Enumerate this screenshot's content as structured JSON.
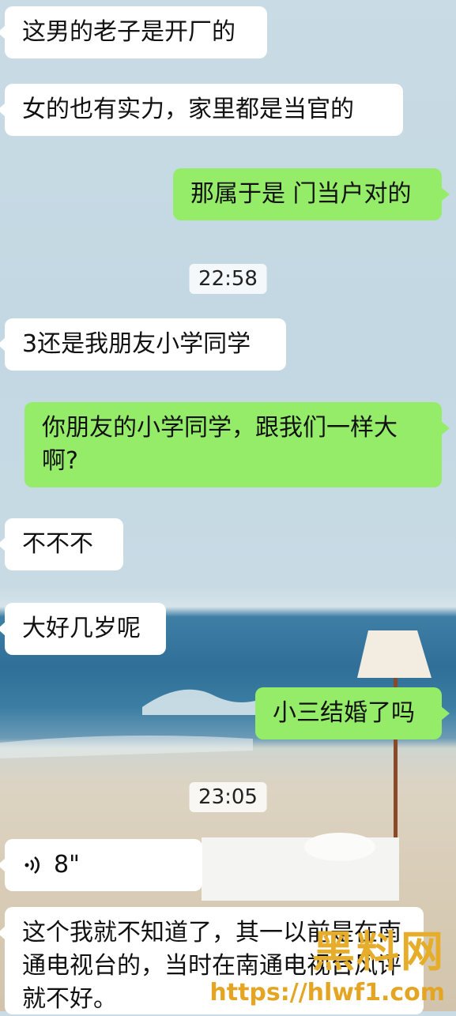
{
  "messages": [
    {
      "side": "left",
      "text": "这男的老子是开厂的"
    },
    {
      "side": "left",
      "text": "女的也有实力，家里都是当官的"
    },
    {
      "side": "right",
      "text": "那属于是 门当户对的"
    },
    {
      "side": "timestamp",
      "text": "22:58"
    },
    {
      "side": "left",
      "text": "3还是我朋友小学同学"
    },
    {
      "side": "right",
      "text": "你朋友的小学同学，跟我们一样大啊?"
    },
    {
      "side": "left",
      "text": "不不不"
    },
    {
      "side": "left",
      "text": "大好几岁呢"
    },
    {
      "side": "right",
      "text": "小三结婚了吗"
    },
    {
      "side": "timestamp",
      "text": "23:05"
    },
    {
      "side": "left",
      "type": "voice",
      "text": "8\""
    },
    {
      "side": "left",
      "text": "这个我就不知道了，其一以前是在南通电视台的，当时在南通电视台风评就不好。"
    }
  ],
  "watermark": {
    "logo": "黑料网",
    "url": "https://hlwf1.com"
  },
  "colors": {
    "incoming": "#ffffff",
    "outgoing": "#95ec69"
  },
  "icons": {
    "voice": "voice-wave-icon"
  }
}
